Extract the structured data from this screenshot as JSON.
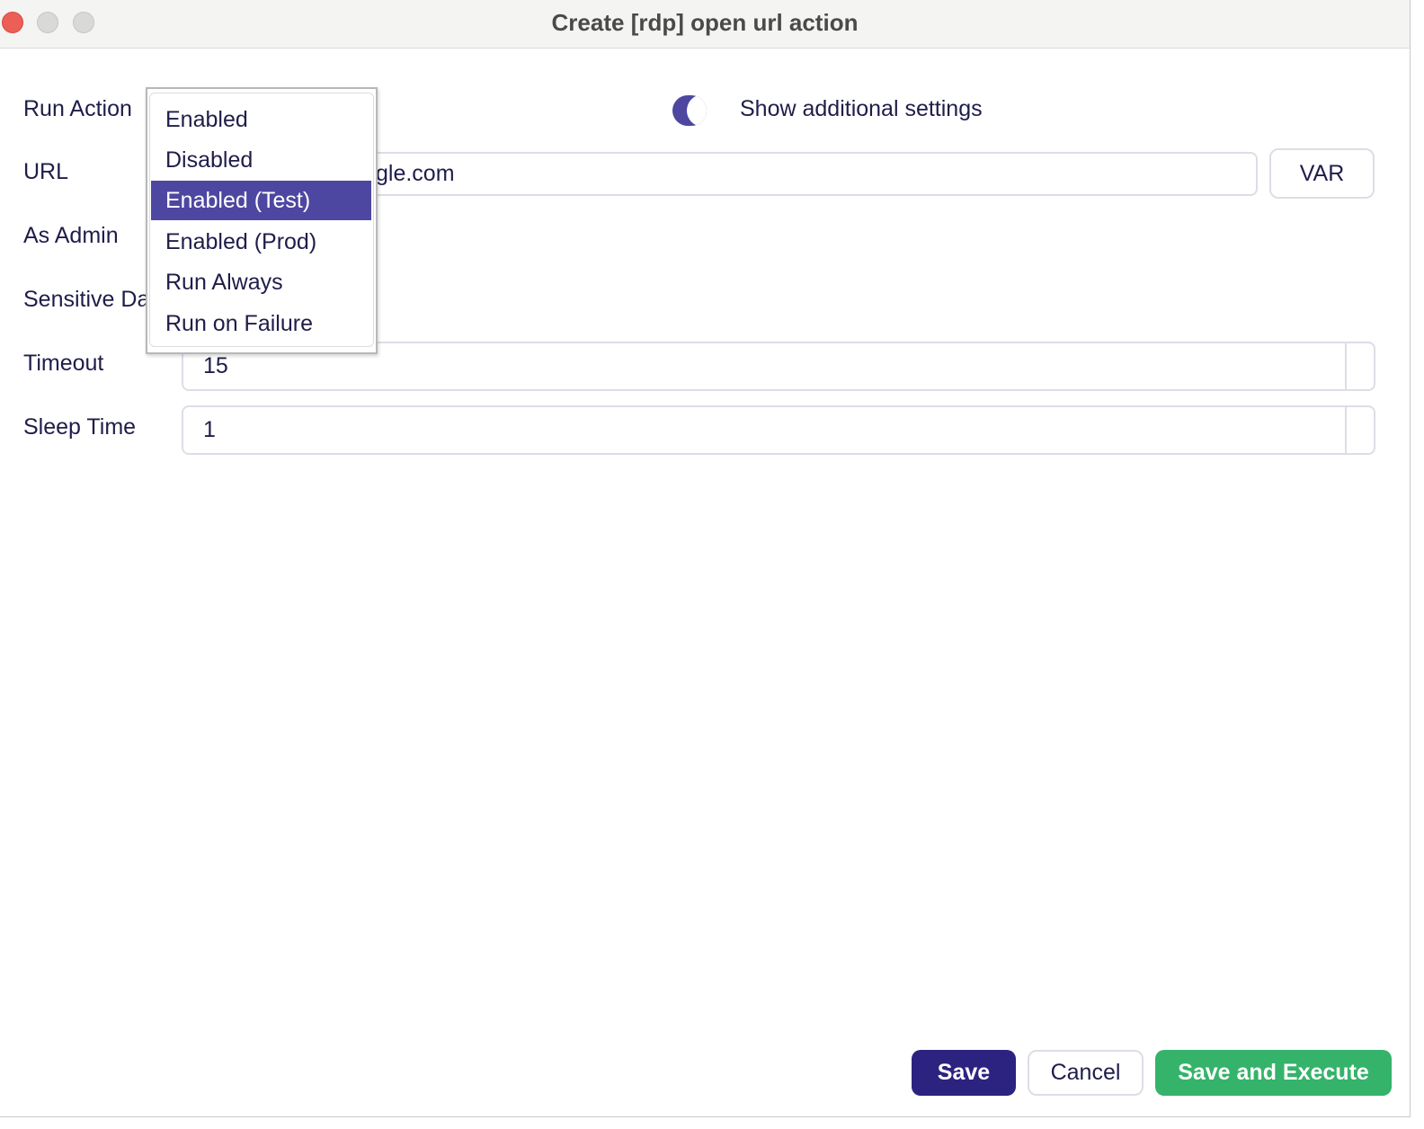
{
  "window": {
    "title": "Create [rdp] open url action"
  },
  "labels": {
    "run_action": "Run Action",
    "url": "URL",
    "as_admin": "As Admin",
    "sensitive_data": "Sensitive Data",
    "timeout": "Timeout",
    "sleep_time": "Sleep Time"
  },
  "toggle": {
    "label": "Show additional settings",
    "state": "on"
  },
  "url_field": {
    "visible_value": "gle.com"
  },
  "var_button": "VAR",
  "timeout_field": {
    "value": "15"
  },
  "sleep_time_field": {
    "value": "1"
  },
  "run_action_dropdown": {
    "options": [
      "Enabled",
      "Disabled",
      "Enabled (Test)",
      "Enabled (Prod)",
      "Run Always",
      "Run on Failure"
    ],
    "highlighted": "Enabled (Test)"
  },
  "footer": {
    "save": "Save",
    "cancel": "Cancel",
    "save_and_execute": "Save and Execute"
  },
  "colors": {
    "accent": "#4e47a1",
    "primary_button": "#2c2380",
    "execute_button": "#35b36a",
    "text": "#1f1d4a"
  }
}
